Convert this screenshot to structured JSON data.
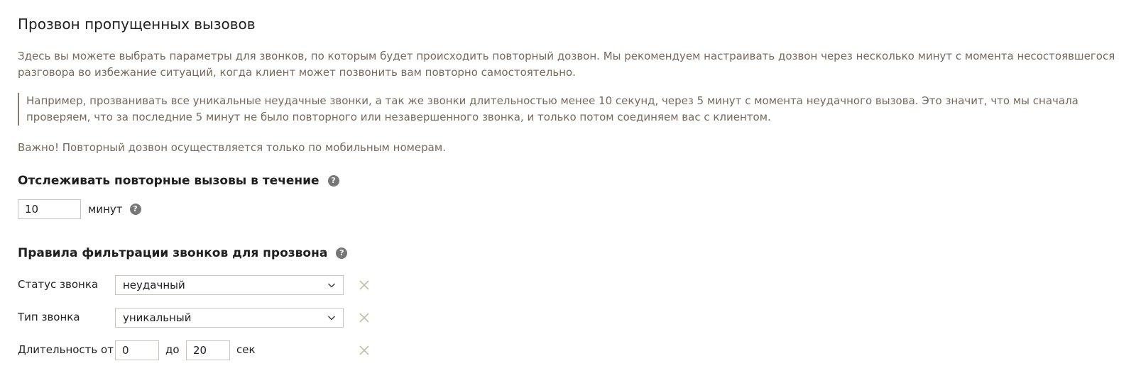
{
  "page": {
    "title": "Прозвон пропущенных вызовов",
    "intro": "Здесь вы можете выбрать параметры для звонков, по которым будет происходить повторный дозвон. Мы рекомендуем настраивать дозвон через несколько минут с момента несостоявшегося разговора во избежание ситуаций, когда клиент может позвонить вам повторно самостоятельно.",
    "example": "Например, прозванивать все уникальные неудачные звонки, а так же звонки длительностью менее 10 секунд, через 5 минут с момента неудачного вызова. Это значит, что мы сначала проверяем, что за последние 5 минут не было повторного или незавершенного звонка, и только потом соединяем вас с клиентом.",
    "important": "Важно! Повторный дозвон осуществляется только по мобильным номерам."
  },
  "tracking": {
    "heading": "Отслеживать повторные вызовы в течение",
    "help_icon": "question-circle-icon",
    "value": "10",
    "unit": "минут",
    "unit_help_icon": "question-circle-icon"
  },
  "rules": {
    "heading": "Правила фильтрации звонков для прозвона",
    "help_icon": "question-circle-icon",
    "status": {
      "label": "Статус звонка",
      "value": "неудачный",
      "remove_icon": "close-icon"
    },
    "type": {
      "label": "Тип звонка",
      "value": "уникальный",
      "remove_icon": "close-icon"
    },
    "duration": {
      "label": "Длительность от",
      "from": "0",
      "separator": "до",
      "to": "20",
      "unit": "сек",
      "remove_icon": "close-icon"
    }
  },
  "colors": {
    "muted_text": "#76695c",
    "help_icon_bg": "#777777",
    "remove_icon": "#c8b9a8",
    "input_border": "#c9c4bd"
  },
  "help_glyph": "?"
}
